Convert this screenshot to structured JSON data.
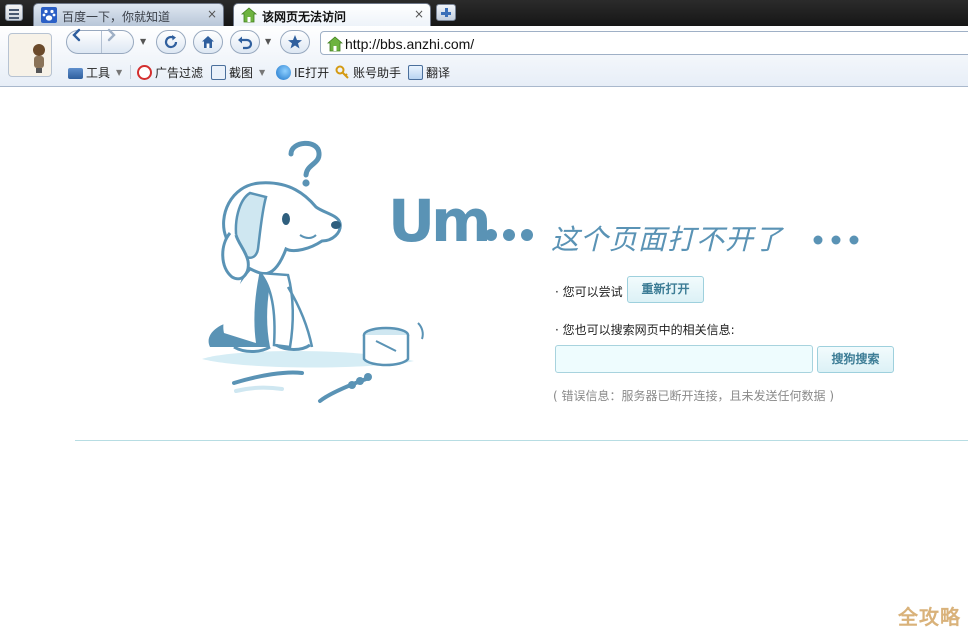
{
  "tabs": [
    {
      "title": "百度一下，你就知道",
      "active": false,
      "close": "×"
    },
    {
      "title": "该网页无法访问",
      "active": true,
      "close": "×"
    }
  ],
  "toolbar": {
    "url": "http://bbs.anzhi.com/"
  },
  "favorites": [
    {
      "label": "工具",
      "icon": "toolbox-icon",
      "has_menu": true
    },
    {
      "label": "广告过滤",
      "icon": "ad-block-icon",
      "has_menu": false
    },
    {
      "label": "截图",
      "icon": "screenshot-icon",
      "has_menu": true
    },
    {
      "label": "IE打开",
      "icon": "ie-icon",
      "has_menu": false
    },
    {
      "label": "账号助手",
      "icon": "key-icon",
      "has_menu": false
    },
    {
      "label": "翻译",
      "icon": "translate-icon",
      "has_menu": false
    }
  ],
  "error_page": {
    "heading_um": "Um",
    "heading_text": "这个页面打不开了",
    "try_label": "· 您可以尝试",
    "reopen_button": "重新打开",
    "search_label": "· 您也可以搜索网页中的相关信息:",
    "search_value": "",
    "search_button": "搜狗搜索",
    "error_info": "( 错误信息：服务器已断开连接，且未发送任何数据 )"
  },
  "watermark": "全攻略",
  "colors": {
    "accent_blue": "#5a93b5",
    "button_text": "#3d7d96",
    "input_border": "#a8d3de",
    "divider": "#b7dde3",
    "watermark": "#d9b27a"
  }
}
